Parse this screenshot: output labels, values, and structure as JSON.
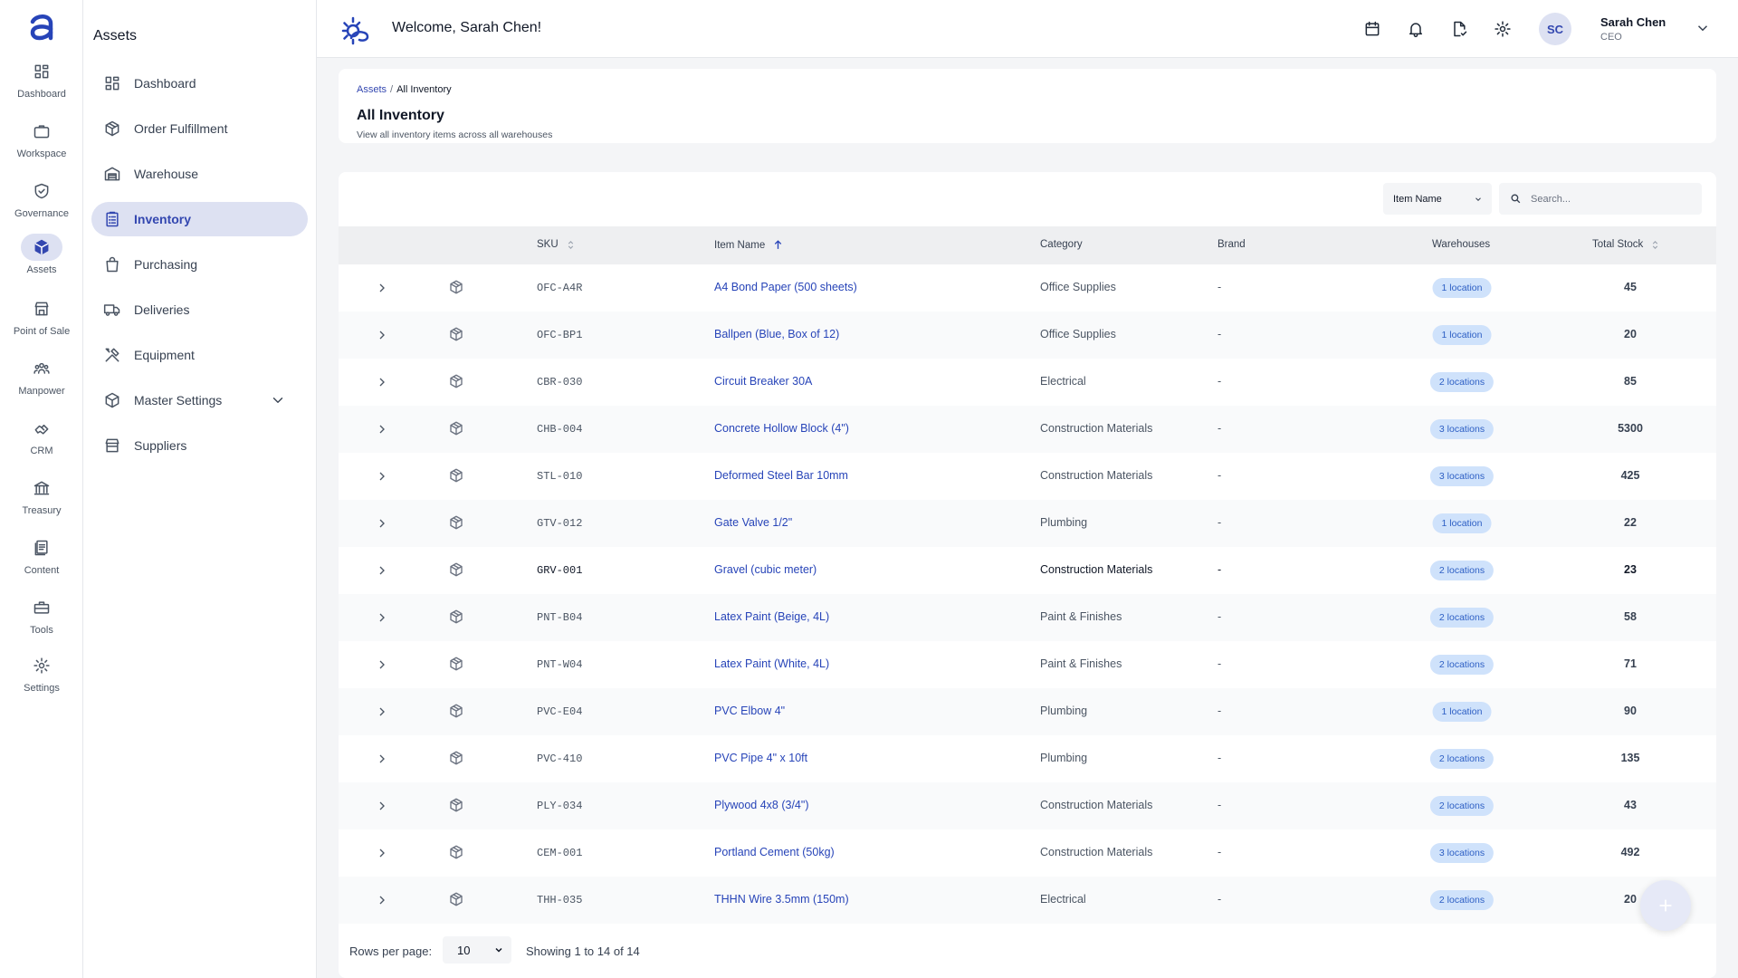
{
  "rail": {
    "items": [
      {
        "label": "Dashboard",
        "icon": "dashboard-icon"
      },
      {
        "label": "Workspace",
        "icon": "briefcase-icon"
      },
      {
        "label": "Governance",
        "icon": "shield-icon"
      },
      {
        "label": "Assets",
        "icon": "cube-icon",
        "active": true
      },
      {
        "label": "Point of Sale",
        "icon": "store-icon"
      },
      {
        "label": "Manpower",
        "icon": "people-icon"
      },
      {
        "label": "CRM",
        "icon": "handshake-icon"
      },
      {
        "label": "Treasury",
        "icon": "bank-icon"
      },
      {
        "label": "Content",
        "icon": "document-icon"
      },
      {
        "label": "Tools",
        "icon": "toolbox-icon"
      },
      {
        "label": "Settings",
        "icon": "gear-icon"
      }
    ]
  },
  "sidebar": {
    "title": "Assets",
    "items": [
      {
        "label": "Dashboard",
        "icon": "dashboard-icon"
      },
      {
        "label": "Order Fulfillment",
        "icon": "package-icon"
      },
      {
        "label": "Warehouse",
        "icon": "warehouse-icon"
      },
      {
        "label": "Inventory",
        "icon": "clipboard-icon",
        "active": true
      },
      {
        "label": "Purchasing",
        "icon": "shopping-bag-icon"
      },
      {
        "label": "Deliveries",
        "icon": "truck-icon"
      },
      {
        "label": "Equipment",
        "icon": "tools-icon"
      },
      {
        "label": "Master Settings",
        "icon": "box-icon"
      },
      {
        "label": "Suppliers",
        "icon": "store-icon"
      }
    ]
  },
  "header": {
    "welcome": "Welcome, Sarah Chen!",
    "user": {
      "initials": "SC",
      "name": "Sarah Chen",
      "role": "CEO"
    }
  },
  "page": {
    "breadcrumb": {
      "parent": "Assets",
      "separator": "/",
      "current": "All Inventory"
    },
    "title": "All Inventory",
    "subtitle": "View all inventory items across all warehouses"
  },
  "filters": {
    "field_selected": "Item Name",
    "search_placeholder": "Search..."
  },
  "table": {
    "columns": {
      "sku": "SKU",
      "item_name": "Item Name",
      "category": "Category",
      "brand": "Brand",
      "warehouses": "Warehouses",
      "total_stock": "Total Stock"
    },
    "rows": [
      {
        "sku": "OFC-A4R",
        "name": "A4 Bond Paper (500 sheets)",
        "category": "Office Supplies",
        "brand": "-",
        "warehouses": "1 location",
        "stock": "45"
      },
      {
        "sku": "OFC-BP1",
        "name": "Ballpen (Blue, Box of 12)",
        "category": "Office Supplies",
        "brand": "-",
        "warehouses": "1 location",
        "stock": "20"
      },
      {
        "sku": "CBR-030",
        "name": "Circuit Breaker 30A",
        "category": "Electrical",
        "brand": "-",
        "warehouses": "2 locations",
        "stock": "85"
      },
      {
        "sku": "CHB-004",
        "name": "Concrete Hollow Block (4\")",
        "category": "Construction Materials",
        "brand": "-",
        "warehouses": "3 locations",
        "stock": "5300"
      },
      {
        "sku": "STL-010",
        "name": "Deformed Steel Bar 10mm",
        "category": "Construction Materials",
        "brand": "-",
        "warehouses": "3 locations",
        "stock": "425"
      },
      {
        "sku": "GTV-012",
        "name": "Gate Valve 1/2\"",
        "category": "Plumbing",
        "brand": "-",
        "warehouses": "1 location",
        "stock": "22"
      },
      {
        "sku": "GRV-001",
        "name": "Gravel (cubic meter)",
        "category": "Construction Materials",
        "brand": "-",
        "warehouses": "2 locations",
        "stock": "23"
      },
      {
        "sku": "PNT-B04",
        "name": "Latex Paint (Beige, 4L)",
        "category": "Paint & Finishes",
        "brand": "-",
        "warehouses": "2 locations",
        "stock": "58"
      },
      {
        "sku": "PNT-W04",
        "name": "Latex Paint (White, 4L)",
        "category": "Paint & Finishes",
        "brand": "-",
        "warehouses": "2 locations",
        "stock": "71"
      },
      {
        "sku": "PVC-E04",
        "name": "PVC Elbow 4\"",
        "category": "Plumbing",
        "brand": "-",
        "warehouses": "1 location",
        "stock": "90"
      },
      {
        "sku": "PVC-410",
        "name": "PVC Pipe 4\" x 10ft",
        "category": "Plumbing",
        "brand": "-",
        "warehouses": "2 locations",
        "stock": "135"
      },
      {
        "sku": "PLY-034",
        "name": "Plywood 4x8 (3/4\")",
        "category": "Construction Materials",
        "brand": "-",
        "warehouses": "2 locations",
        "stock": "43"
      },
      {
        "sku": "CEM-001",
        "name": "Portland Cement (50kg)",
        "category": "Construction Materials",
        "brand": "-",
        "warehouses": "3 locations",
        "stock": "492"
      },
      {
        "sku": "THH-035",
        "name": "THHN Wire 3.5mm (150m)",
        "category": "Electrical",
        "brand": "-",
        "warehouses": "2 locations",
        "stock": "20"
      }
    ]
  },
  "pagination": {
    "rows_per_page_label": "Rows per page:",
    "rows_per_page": "10",
    "showing": "Showing 1 to 14 of 14"
  },
  "colors": {
    "accent": "#3347b0",
    "link": "#2744b8",
    "badge_bg": "#cfe2fb",
    "badge_text": "#2d5fc4"
  }
}
